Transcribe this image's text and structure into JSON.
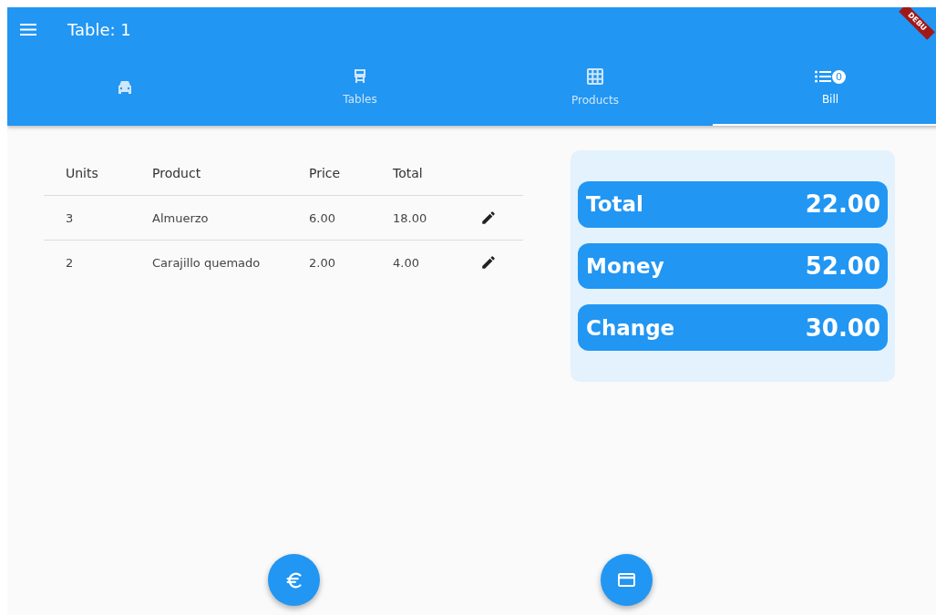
{
  "app_bar": {
    "title": "Table: 1"
  },
  "debug_banner": {
    "text": "DEBU"
  },
  "tabs": [
    {
      "selected": false
    },
    {
      "label": "Tables",
      "selected": false
    },
    {
      "label": "Products",
      "selected": false
    },
    {
      "label": "Bill",
      "badge": "0",
      "selected": true
    }
  ],
  "table": {
    "columns": [
      "Units",
      "Product",
      "Price",
      "Total"
    ],
    "rows": [
      {
        "cells": [
          "3",
          "Almuerzo",
          "6.00",
          "18.00"
        ]
      },
      {
        "cells": [
          "2",
          "Carajillo quemado",
          "2.00",
          "4.00"
        ]
      }
    ]
  },
  "summary": [
    {
      "label": "Total",
      "value": "22.00"
    },
    {
      "label": "Money",
      "value": "52.00"
    },
    {
      "label": "Change",
      "value": "30.00"
    }
  ]
}
